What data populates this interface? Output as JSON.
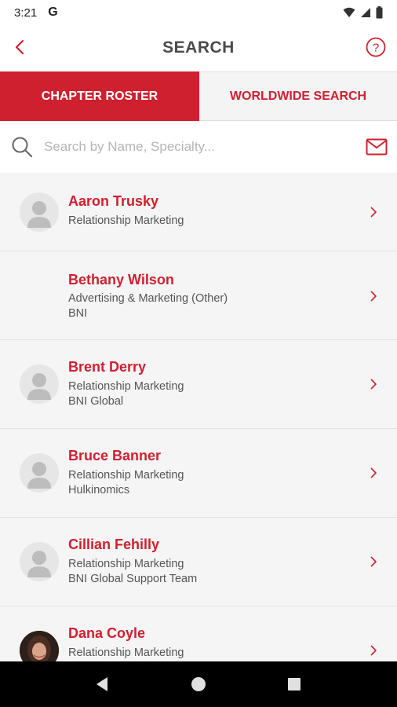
{
  "status_bar": {
    "time": "3:21",
    "notification_letter": "G"
  },
  "header": {
    "title": "SEARCH"
  },
  "tabs": [
    {
      "label": "CHAPTER ROSTER",
      "active": true
    },
    {
      "label": "WORLDWIDE SEARCH",
      "active": false
    }
  ],
  "search": {
    "placeholder": "Search by Name, Specialty...",
    "value": ""
  },
  "members": [
    {
      "name": "Aaron Trusky",
      "specialty": "Relationship Marketing",
      "company": "",
      "avatar": "placeholder"
    },
    {
      "name": "Bethany Wilson",
      "specialty": "Advertising & Marketing (Other)",
      "company": "BNI",
      "avatar": "none"
    },
    {
      "name": "Brent Derry",
      "specialty": "Relationship Marketing",
      "company": "BNI Global",
      "avatar": "placeholder"
    },
    {
      "name": "Bruce Banner",
      "specialty": "Relationship Marketing",
      "company": "Hulkinomics",
      "avatar": "placeholder"
    },
    {
      "name": "Cillian Fehilly",
      "specialty": "Relationship Marketing",
      "company": "BNI Global Support Team",
      "avatar": "placeholder"
    },
    {
      "name": "Dana Coyle",
      "specialty": "Relationship Marketing",
      "company": "",
      "avatar": "photo"
    }
  ],
  "colors": {
    "brand_red": "#cf2030",
    "list_bg": "#f5f5f5",
    "tab_inactive_bg": "#f4f4f4"
  }
}
